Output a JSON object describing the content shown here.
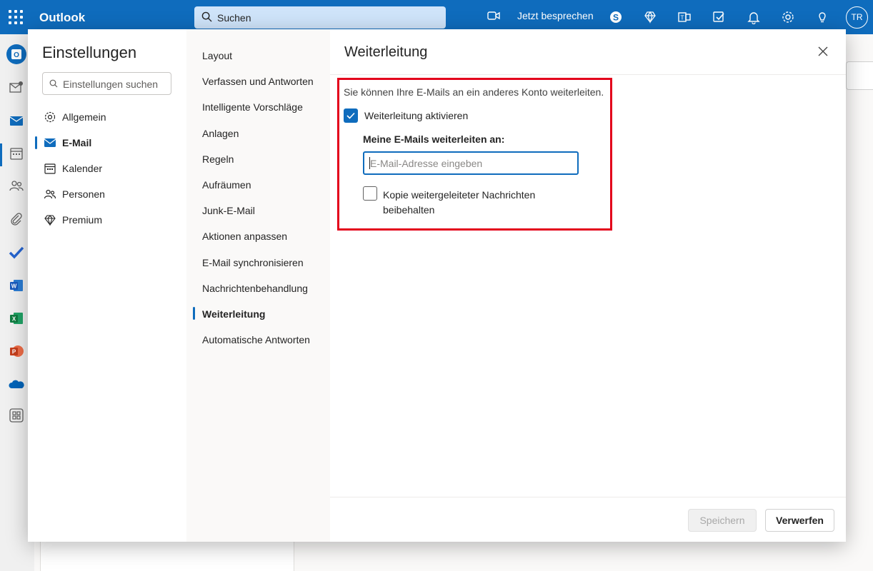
{
  "topbar": {
    "app_name": "Outlook",
    "search_placeholder": "Suchen",
    "meet_label": "Jetzt besprechen",
    "icons": [
      "app-launcher-icon",
      "video-camera-icon",
      "skype-icon",
      "premium-diamond-icon",
      "teams-icon",
      "tasks-icon",
      "bell-icon",
      "gear-icon",
      "lightbulb-icon"
    ],
    "avatar_initials": "TR",
    "brand_color": "#0f6cbd"
  },
  "rail": {
    "icons": [
      "outlook-icon",
      "new-mail-icon",
      "mail-icon",
      "calendar-icon",
      "people-icon",
      "paperclip-icon",
      "todo-check-icon",
      "word-icon",
      "excel-icon",
      "powerpoint-icon",
      "onedrive-icon",
      "more-apps-icon"
    ]
  },
  "settings": {
    "title": "Einstellungen",
    "search_placeholder": "Einstellungen suchen",
    "categories": [
      {
        "label": "Allgemein",
        "icon": "gear-icon"
      },
      {
        "label": "E-Mail",
        "icon": "mail-icon"
      },
      {
        "label": "Kalender",
        "icon": "calendar-icon"
      },
      {
        "label": "Personen",
        "icon": "people-icon"
      },
      {
        "label": "Premium",
        "icon": "diamond-icon"
      }
    ],
    "active_category": "E-Mail",
    "subcategories": [
      "Layout",
      "Verfassen und Antworten",
      "Intelligente Vorschläge",
      "Anlagen",
      "Regeln",
      "Aufräumen",
      "Junk-E-Mail",
      "Aktionen anpassen",
      "E-Mail synchronisieren",
      "Nachrichtenbehandlung",
      "Weiterleitung",
      "Automatische Antworten"
    ],
    "active_subcategory": "Weiterleitung"
  },
  "pane": {
    "title": "Weiterleitung",
    "description": "Sie können Ihre E-Mails an ein anderes Konto weiterleiten.",
    "enable_label": "Weiterleitung aktivieren",
    "enable_checked": true,
    "forward_to_label": "Meine E-Mails weiterleiten an:",
    "email_value": "",
    "email_placeholder": "E-Mail-Adresse eingeben",
    "keep_copy_label": "Kopie weitergeleiteter Nachrichten beibehalten",
    "keep_copy_checked": false,
    "save_label": "Speichern",
    "save_enabled": false,
    "discard_label": "Verwerfen",
    "highlight_color": "#e3001b"
  }
}
